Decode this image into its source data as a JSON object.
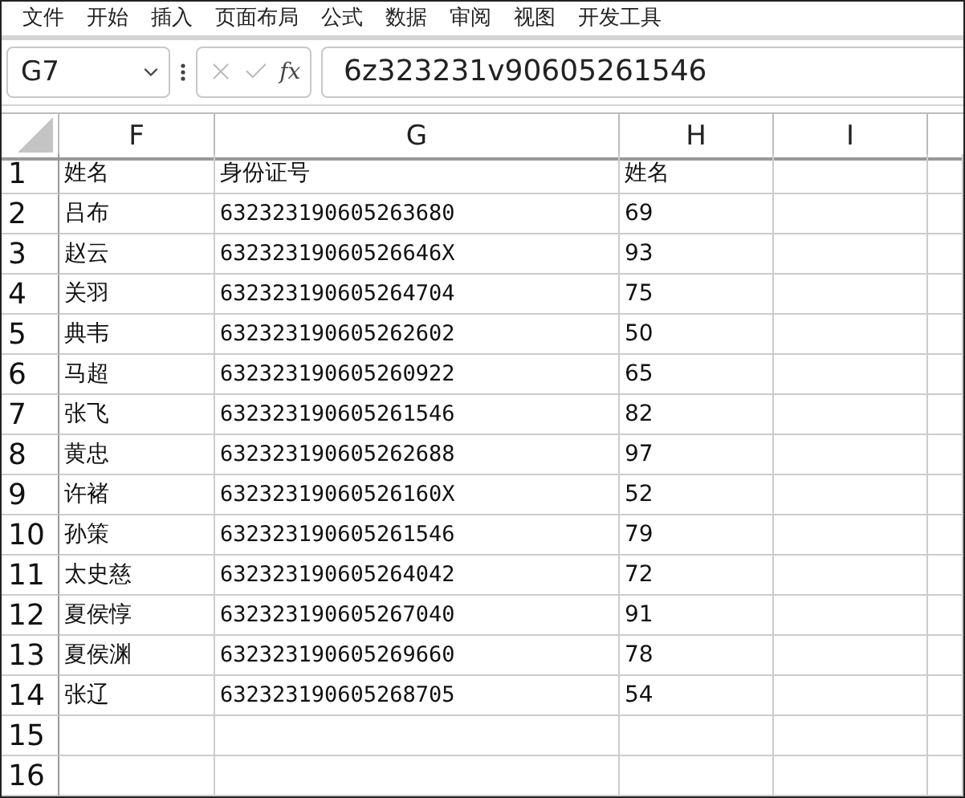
{
  "menu": [
    "文件",
    "开始",
    "插入",
    "页面布局",
    "公式",
    "数据",
    "审阅",
    "视图",
    "开发工具"
  ],
  "formula_bar": {
    "name_box": "G7",
    "function_label": "fx",
    "value": "6z323231v90605261546"
  },
  "columns": [
    "F",
    "G",
    "H",
    "I"
  ],
  "rows": [
    {
      "number": "1",
      "F": "姓名",
      "G": "身份证号",
      "H": "姓名"
    },
    {
      "number": "2",
      "F": "吕布",
      "G": "632323190605263680",
      "H": "69"
    },
    {
      "number": "3",
      "F": "赵云",
      "G": "63232319060526646X",
      "H": "93"
    },
    {
      "number": "4",
      "F": "关羽",
      "G": "632323190605264704",
      "H": "75"
    },
    {
      "number": "5",
      "F": "典韦",
      "G": "632323190605262602",
      "H": "50"
    },
    {
      "number": "6",
      "F": "马超",
      "G": "632323190605260922",
      "H": "65"
    },
    {
      "number": "7",
      "F": "张飞",
      "G": "632323190605261546",
      "H": "82"
    },
    {
      "number": "8",
      "F": "黄忠",
      "G": "632323190605262688",
      "H": "97"
    },
    {
      "number": "9",
      "F": "许褚",
      "G": "63232319060526160X",
      "H": "52"
    },
    {
      "number": "10",
      "F": "孙策",
      "G": "632323190605261546",
      "H": "79"
    },
    {
      "number": "11",
      "F": "太史慈",
      "G": "632323190605264042",
      "H": "72"
    },
    {
      "number": "12",
      "F": "夏侯惇",
      "G": "632323190605267040",
      "H": "91"
    },
    {
      "number": "13",
      "F": "夏侯渊",
      "G": "632323190605269660",
      "H": "78"
    },
    {
      "number": "14",
      "F": "张辽",
      "G": "632323190605268705",
      "H": "54"
    },
    {
      "number": "15"
    },
    {
      "number": "16"
    }
  ]
}
